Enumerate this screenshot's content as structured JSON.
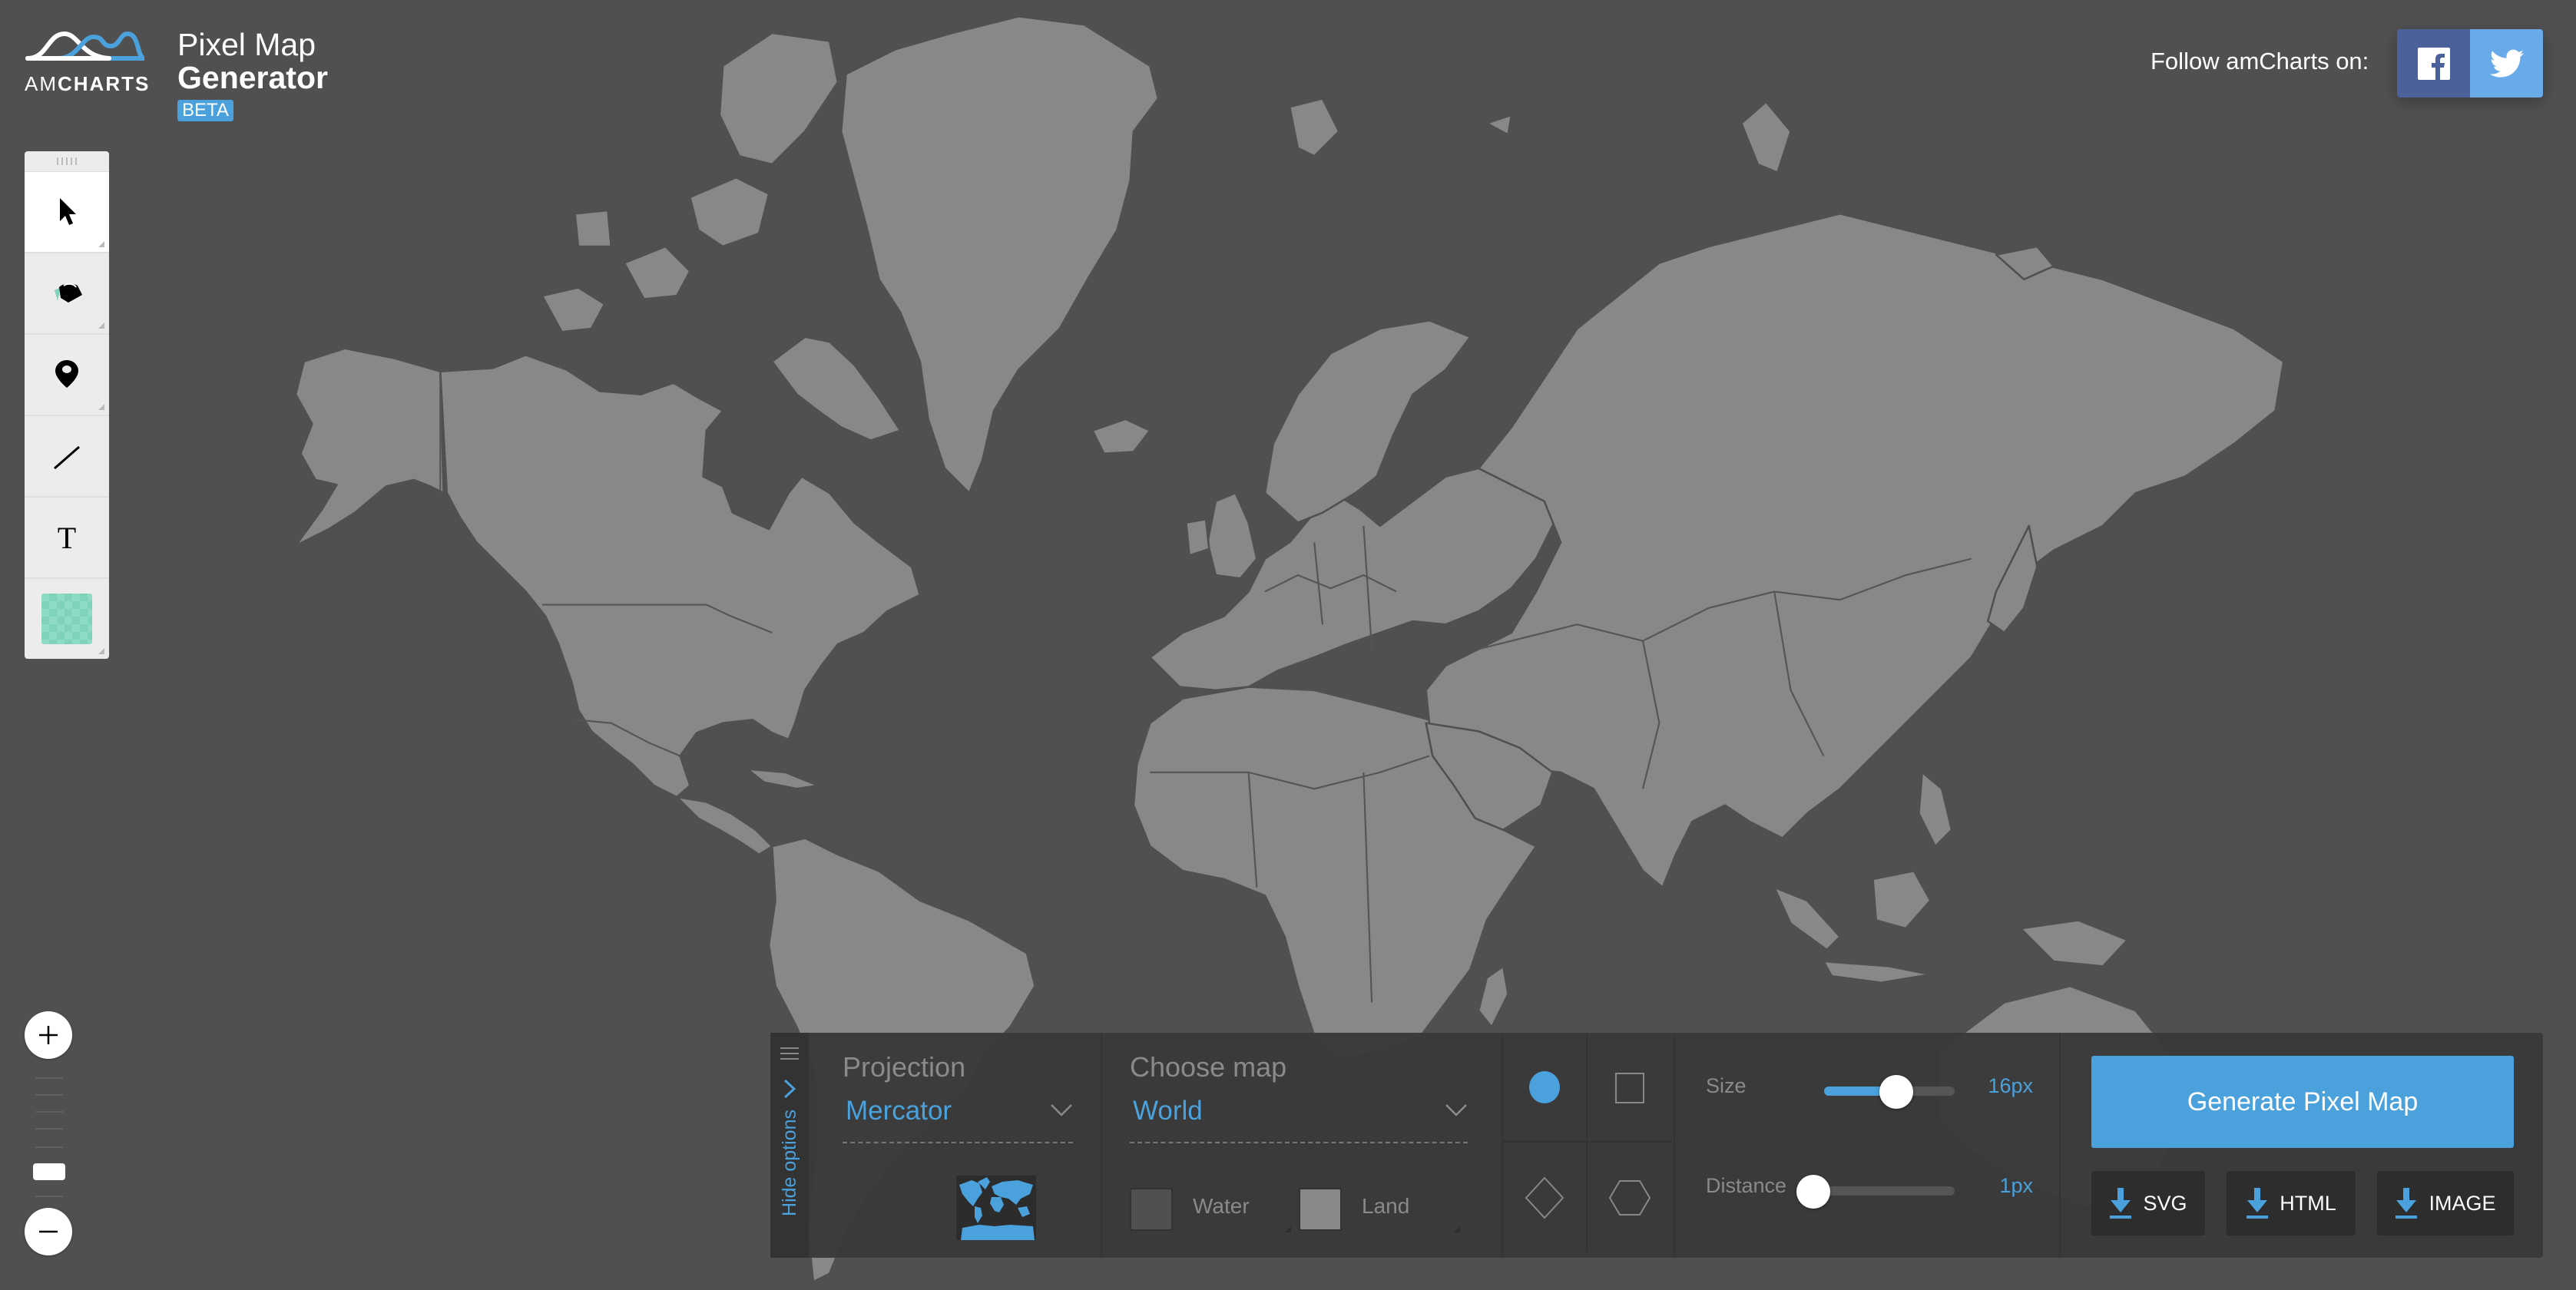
{
  "header": {
    "logo_text_light": "AM",
    "logo_text_bold": "CHARTS",
    "title_line1": "Pixel Map",
    "title_line2": "Generator",
    "badge": "BETA",
    "follow_prefix": "Follow ",
    "follow_brand": "amCharts",
    "follow_suffix": " on:",
    "social": [
      {
        "name": "Facebook",
        "icon": "facebook-icon",
        "color": "#4a6299"
      },
      {
        "name": "Twitter",
        "icon": "twitter-icon",
        "color": "#69aae8"
      }
    ]
  },
  "toolbar": {
    "tools": [
      {
        "id": "select",
        "icon": "cursor-arrow-icon",
        "active": true
      },
      {
        "id": "fill",
        "icon": "paint-bucket-icon",
        "active": false
      },
      {
        "id": "marker",
        "icon": "map-pin-icon",
        "active": false
      },
      {
        "id": "line",
        "icon": "line-icon",
        "active": false
      },
      {
        "id": "text",
        "icon": "text-icon",
        "active": false
      },
      {
        "id": "color",
        "icon": "color-swatch",
        "active": false,
        "color": "#8edcc6"
      }
    ]
  },
  "zoom_control": {
    "zoom_in_icon": "plus-icon",
    "zoom_out_icon": "minus-icon",
    "level_fraction": 0.17
  },
  "map": {
    "background_color": "#505050",
    "land_color": "#888888"
  },
  "options": {
    "hide_label": "Hide options",
    "projection": {
      "label": "Projection",
      "value": "Mercator"
    },
    "map_choice": {
      "label": "Choose map",
      "value": "World"
    },
    "water": {
      "label": "Water",
      "color": "#505050"
    },
    "land": {
      "label": "Land",
      "color": "#888888"
    },
    "shapes": [
      {
        "name": "circle",
        "selected": true
      },
      {
        "name": "square",
        "selected": false
      },
      {
        "name": "diamond",
        "selected": false
      },
      {
        "name": "hexagon",
        "selected": false
      }
    ],
    "size": {
      "label": "Size",
      "value": "16px",
      "fraction": 0.55
    },
    "distance": {
      "label": "Distance",
      "value": "1px",
      "fraction": 0.0
    },
    "generate_label": "Generate Pixel Map",
    "downloads": [
      {
        "label": "SVG"
      },
      {
        "label": "HTML"
      },
      {
        "label": "IMAGE"
      }
    ],
    "accent_color": "#4aa1dc"
  }
}
